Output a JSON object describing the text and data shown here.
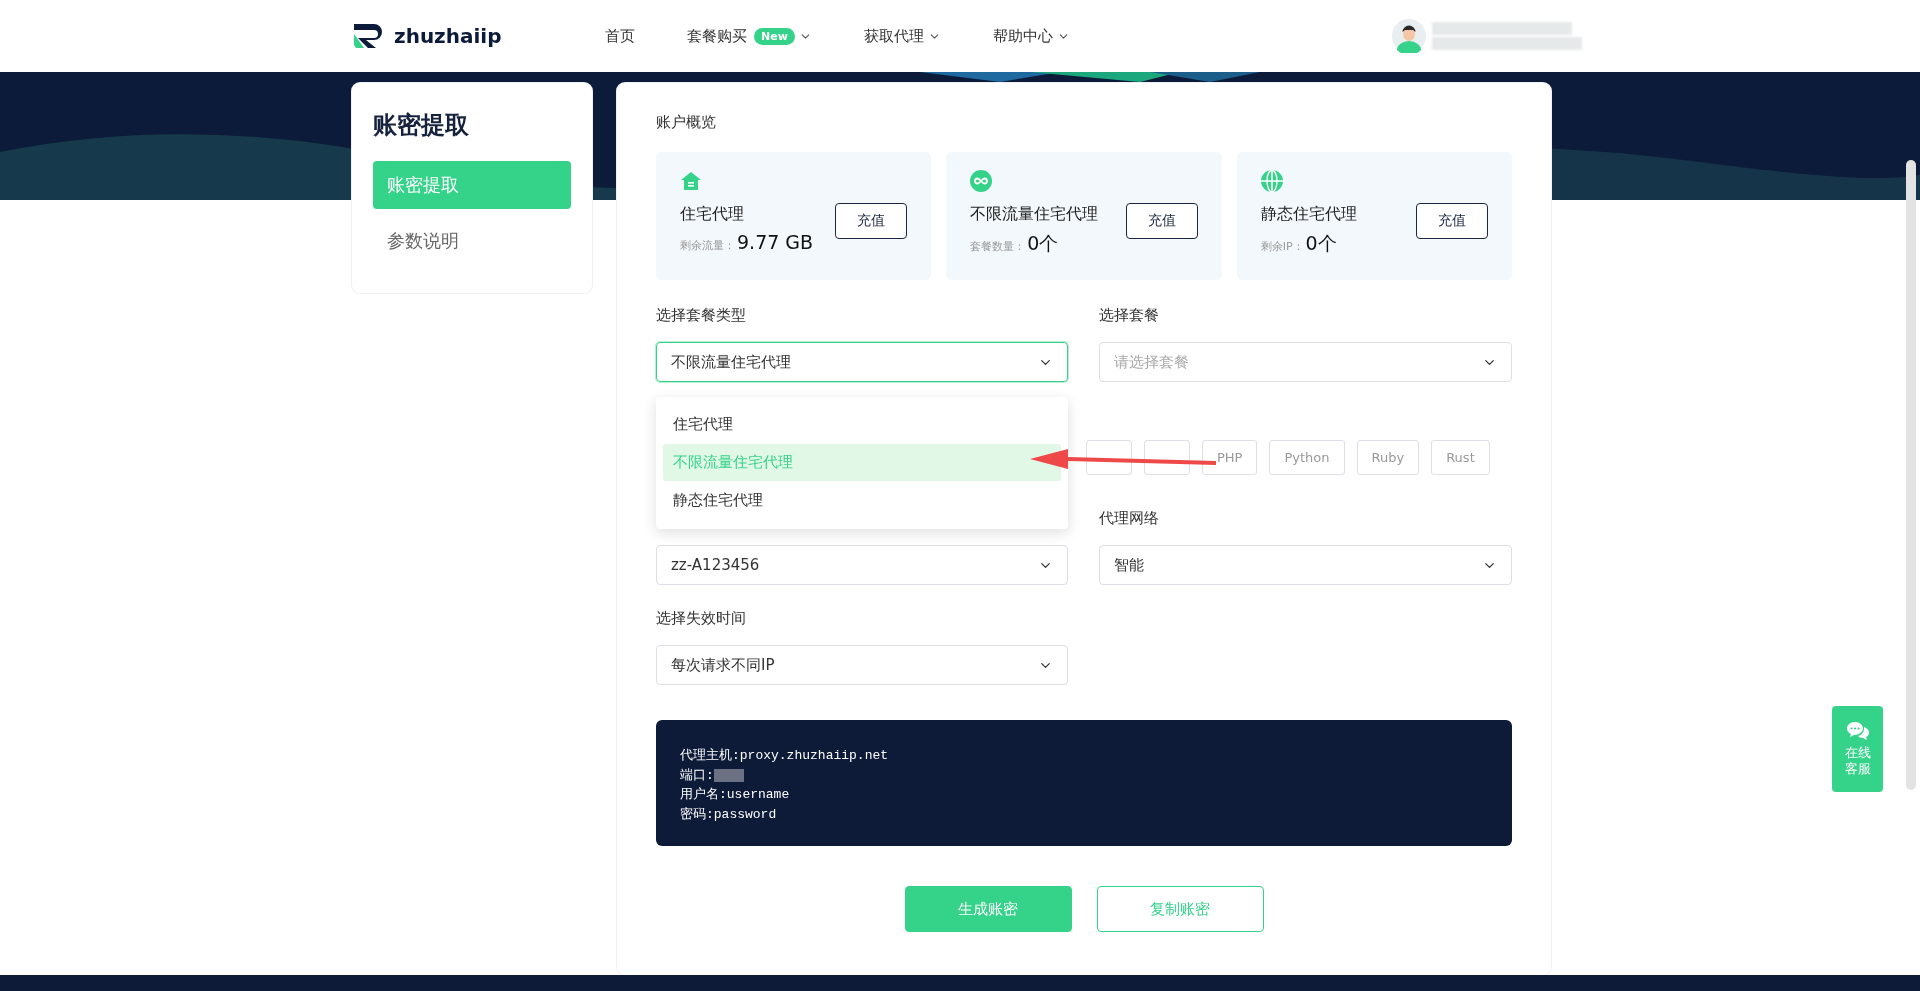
{
  "header": {
    "logo": "zhuzhaiip",
    "nav": [
      {
        "label": "首页",
        "has_menu": false
      },
      {
        "label": "套餐购买",
        "badge": "New",
        "has_menu": true
      },
      {
        "label": "获取代理",
        "has_menu": true
      },
      {
        "label": "帮助中心",
        "has_menu": true
      }
    ]
  },
  "sidebar": {
    "title": "账密提取",
    "items": [
      {
        "label": "账密提取",
        "selected": true
      },
      {
        "label": "参数说明",
        "selected": false
      }
    ]
  },
  "overview": {
    "title": "账户概览",
    "cards": [
      {
        "kind": "house",
        "name": "住宅代理",
        "button": "充值",
        "stat_label": "剩余流量：",
        "stat_value": "9.77 GB"
      },
      {
        "kind": "infinity",
        "name": "不限流量住宅代理",
        "button": "充值",
        "stat_label": "套餐数量：",
        "stat_value": "0个"
      },
      {
        "kind": "globe",
        "name": "静态住宅代理",
        "button": "充值",
        "stat_label": "剩余IP：",
        "stat_value": "0个"
      }
    ]
  },
  "package_type": {
    "label": "选择套餐类型",
    "value": "不限流量住宅代理",
    "open": true,
    "options": [
      {
        "label": "住宅代理",
        "selected": false
      },
      {
        "label": "不限流量住宅代理",
        "selected": true
      },
      {
        "label": "静态住宅代理",
        "selected": false
      }
    ]
  },
  "package": {
    "label": "选择套餐",
    "placeholder": "请选择套餐"
  },
  "languages": [
    {
      "covered": true
    },
    {
      "covered": true
    },
    {
      "label": "PHP",
      "covered": false
    },
    {
      "label": "Python",
      "covered": false
    },
    {
      "label": "Ruby",
      "covered": false
    },
    {
      "label": "Rust",
      "covered": false
    }
  ],
  "account": {
    "value": "zz-A123456"
  },
  "network": {
    "label": "代理网络",
    "value": "智能"
  },
  "expiry": {
    "label": "选择失效时间",
    "value": "每次请求不同IP"
  },
  "credentials": [
    {
      "label": "代理主机:",
      "value": "proxy.zhuzhaiip.net",
      "redacted": false
    },
    {
      "label": "端口:",
      "redacted": true
    },
    {
      "label": "用户名:",
      "value": "username",
      "redacted": false
    },
    {
      "label": "密码:",
      "value": "password",
      "redacted": false
    }
  ],
  "actions": [
    {
      "label": "生成账密",
      "kind": "primary"
    },
    {
      "label": "复制账密",
      "kind": "outline"
    }
  ],
  "chat_widget": {
    "label": "在线客服"
  }
}
